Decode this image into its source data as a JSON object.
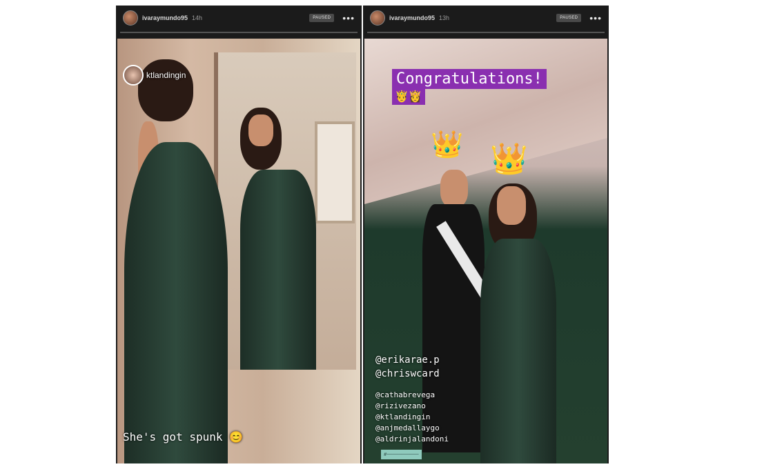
{
  "stories": [
    {
      "username": "ivaraymundo95",
      "time": "14h",
      "paused_label": "PAUSED",
      "more_icon": "ellipsis-icon",
      "mention": "ktlandingin",
      "caption": "She's got spunk 😊"
    },
    {
      "username": "ivaraymundo95",
      "time": "13h",
      "paused_label": "PAUSED",
      "more_icon": "ellipsis-icon",
      "sticker": "Congratulations!",
      "stickers_emoji": "🤴👸",
      "tags_main": [
        "@erikarae.p",
        "@chriswcard"
      ],
      "tags_small": [
        "@cathabrevega",
        "@rizivezano",
        "@ktlandingin",
        "@anjmedallaygo",
        "@aldrinjalandoni"
      ]
    }
  ]
}
